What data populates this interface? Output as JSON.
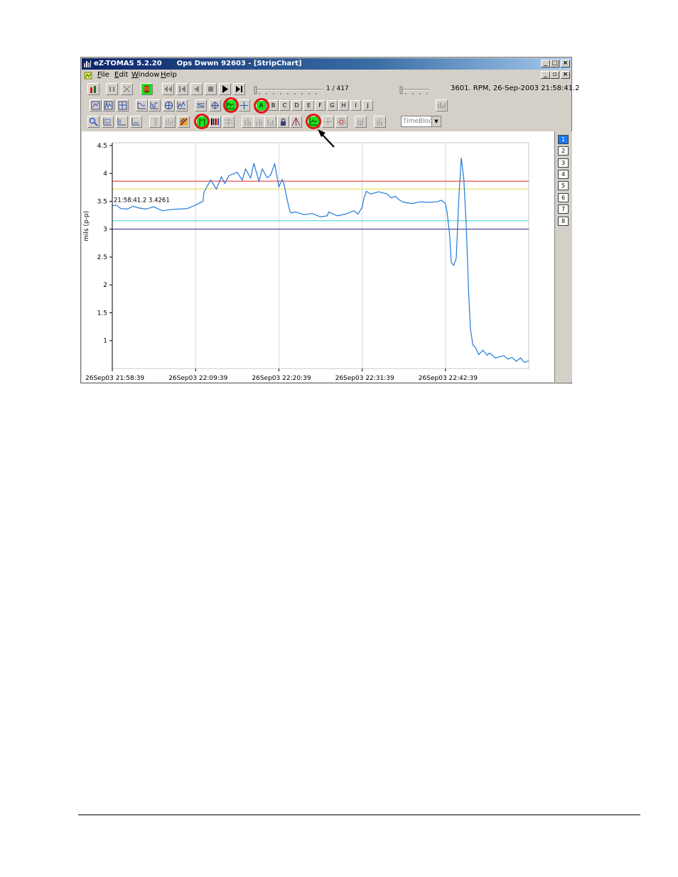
{
  "window": {
    "app_title": "eZ-TOMAS 5.2.20",
    "doc_title": "Ops Dwwn 92603 - [StripChart]"
  },
  "menu": {
    "items": [
      "File",
      "Edit",
      "Window",
      "Help"
    ]
  },
  "playback": {
    "frame_label": "1 / 417",
    "status_text": "3601. RPM,  26-Sep-2003 21:58:41.2"
  },
  "channel_letters": [
    "A",
    "B",
    "C",
    "D",
    "E",
    "F",
    "G",
    "H",
    "I",
    "J"
  ],
  "timeblock": {
    "value": "TimeBlock"
  },
  "side_channels": {
    "items": [
      "1",
      "2",
      "3",
      "4",
      "5",
      "6",
      "7",
      "8"
    ],
    "selected": "1"
  },
  "colors": {
    "trace": "#1f7ad8",
    "ref_red": "#e02020",
    "ref_yellow": "#e8d840",
    "ref_cyan": "#30d8d8",
    "ref_navy": "#202080",
    "highlight_ring": "#e4141a",
    "active_button": "#20e020"
  },
  "icons": [
    "playback-controls",
    "zoom-icon",
    "lock-icon",
    "cursor-arrow"
  ],
  "chart_data": {
    "type": "line",
    "ylabel": "mils (p-p)",
    "ylim": [
      0.5,
      4.55
    ],
    "yticks": [
      1,
      1.5,
      2,
      2.5,
      3,
      3.5,
      4,
      4.5
    ],
    "ytick_labels": [
      "1",
      "1.5",
      "2",
      "2.5",
      "3",
      "3.5",
      "4",
      "4.5"
    ],
    "xlim": [
      0,
      50
    ],
    "xtick_positions": [
      0,
      10,
      20,
      30,
      40
    ],
    "xtick_labels": [
      "26Sep03 21:58:39",
      "26Sep03 22:09:39",
      "26Sep03 22:20:39",
      "26Sep03 22:31:39",
      "26Sep03 22:42:39"
    ],
    "cursor_label": "21:58:41.2   3.4261",
    "reference_lines": [
      {
        "color": "#e02020",
        "value": 3.86
      },
      {
        "color": "#e8d840",
        "value": 3.72
      },
      {
        "color": "#30d8d8",
        "value": 3.15
      },
      {
        "color": "#202080",
        "value": 3.0
      }
    ],
    "series": [
      {
        "color": "#1f7ad8",
        "x": [
          0,
          0.5,
          1,
          1.8,
          2.5,
          3.2,
          4,
          5,
          6,
          7,
          8,
          9,
          10,
          10.9,
          11,
          11.8,
          12.5,
          13.1,
          13.5,
          14,
          15,
          15.6,
          16,
          16.6,
          17,
          17.6,
          18,
          18.6,
          19,
          19.5,
          20,
          20.4,
          20.6,
          21,
          21.3,
          21.5,
          22,
          23,
          24,
          25,
          25.8,
          26,
          27,
          28,
          29,
          29.5,
          30,
          30.2,
          30.5,
          31,
          32,
          33,
          33.5,
          34,
          34.5,
          35,
          36,
          37,
          38,
          39,
          39.5,
          40,
          40.2,
          40.5,
          40.7,
          41,
          41.3,
          41.6,
          41.9,
          42.2,
          42.5,
          42.8,
          43,
          43.3,
          43.6,
          44,
          44.5,
          45,
          45.3,
          46,
          47,
          47.5,
          48,
          48.5,
          49,
          49.5,
          50
        ],
        "y": [
          3.42,
          3.43,
          3.37,
          3.36,
          3.41,
          3.38,
          3.36,
          3.4,
          3.33,
          3.35,
          3.36,
          3.37,
          3.43,
          3.5,
          3.66,
          3.88,
          3.72,
          3.94,
          3.82,
          3.96,
          4.02,
          3.88,
          4.08,
          3.92,
          4.18,
          3.86,
          4.08,
          3.92,
          3.97,
          4.17,
          3.76,
          3.89,
          3.82,
          3.53,
          3.33,
          3.29,
          3.31,
          3.26,
          3.28,
          3.22,
          3.24,
          3.31,
          3.24,
          3.27,
          3.33,
          3.27,
          3.39,
          3.55,
          3.68,
          3.63,
          3.67,
          3.63,
          3.56,
          3.59,
          3.52,
          3.48,
          3.46,
          3.49,
          3.48,
          3.49,
          3.52,
          3.46,
          3.3,
          2.9,
          2.4,
          2.35,
          2.48,
          3.55,
          4.28,
          3.9,
          3.05,
          1.8,
          1.2,
          0.92,
          0.88,
          0.75,
          0.83,
          0.74,
          0.78,
          0.69,
          0.73,
          0.67,
          0.7,
          0.63,
          0.69,
          0.61,
          0.64
        ]
      }
    ]
  }
}
